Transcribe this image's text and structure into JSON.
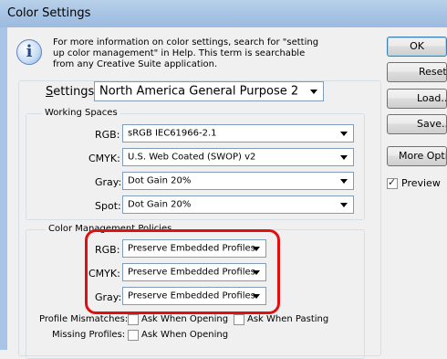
{
  "window": {
    "title": "Color Settings"
  },
  "info": {
    "icon": "info-icon",
    "text": "For more information on color settings, search for \"setting up color management\" in Help. This term is searchable from any Creative Suite application."
  },
  "settings": {
    "label": "Settings:",
    "value": "North America General Purpose 2"
  },
  "working_spaces": {
    "title": "Working Spaces",
    "rgb": {
      "label": "RGB:",
      "value": "sRGB IEC61966-2.1"
    },
    "cmyk": {
      "label": "CMYK:",
      "value": "U.S. Web Coated (SWOP) v2"
    },
    "gray": {
      "label": "Gray:",
      "value": "Dot Gain 20%"
    },
    "spot": {
      "label": "Spot:",
      "value": "Dot Gain 20%"
    }
  },
  "cm_policies": {
    "title": "Color Management Policies",
    "rgb": {
      "label": "RGB:",
      "value": "Preserve Embedded Profiles"
    },
    "cmyk": {
      "label": "CMYK:",
      "value": "Preserve Embedded Profiles"
    },
    "gray": {
      "label": "Gray:",
      "value": "Preserve Embedded Profiles"
    },
    "profile_mismatches": {
      "label": "Profile Mismatches:",
      "ask_opening": "Ask When Opening",
      "ask_pasting": "Ask When Pasting"
    },
    "missing_profiles": {
      "label": "Missing Profiles:",
      "ask_opening": "Ask When Opening"
    }
  },
  "buttons": {
    "ok": "OK",
    "reset": "Reset",
    "load": "Load...",
    "save": "Save...",
    "more_options": "More Options"
  },
  "preview": {
    "label": "Preview",
    "checked": true
  },
  "colors": {
    "highlight": "#e01010",
    "titlebar": "#a6c3e4"
  }
}
